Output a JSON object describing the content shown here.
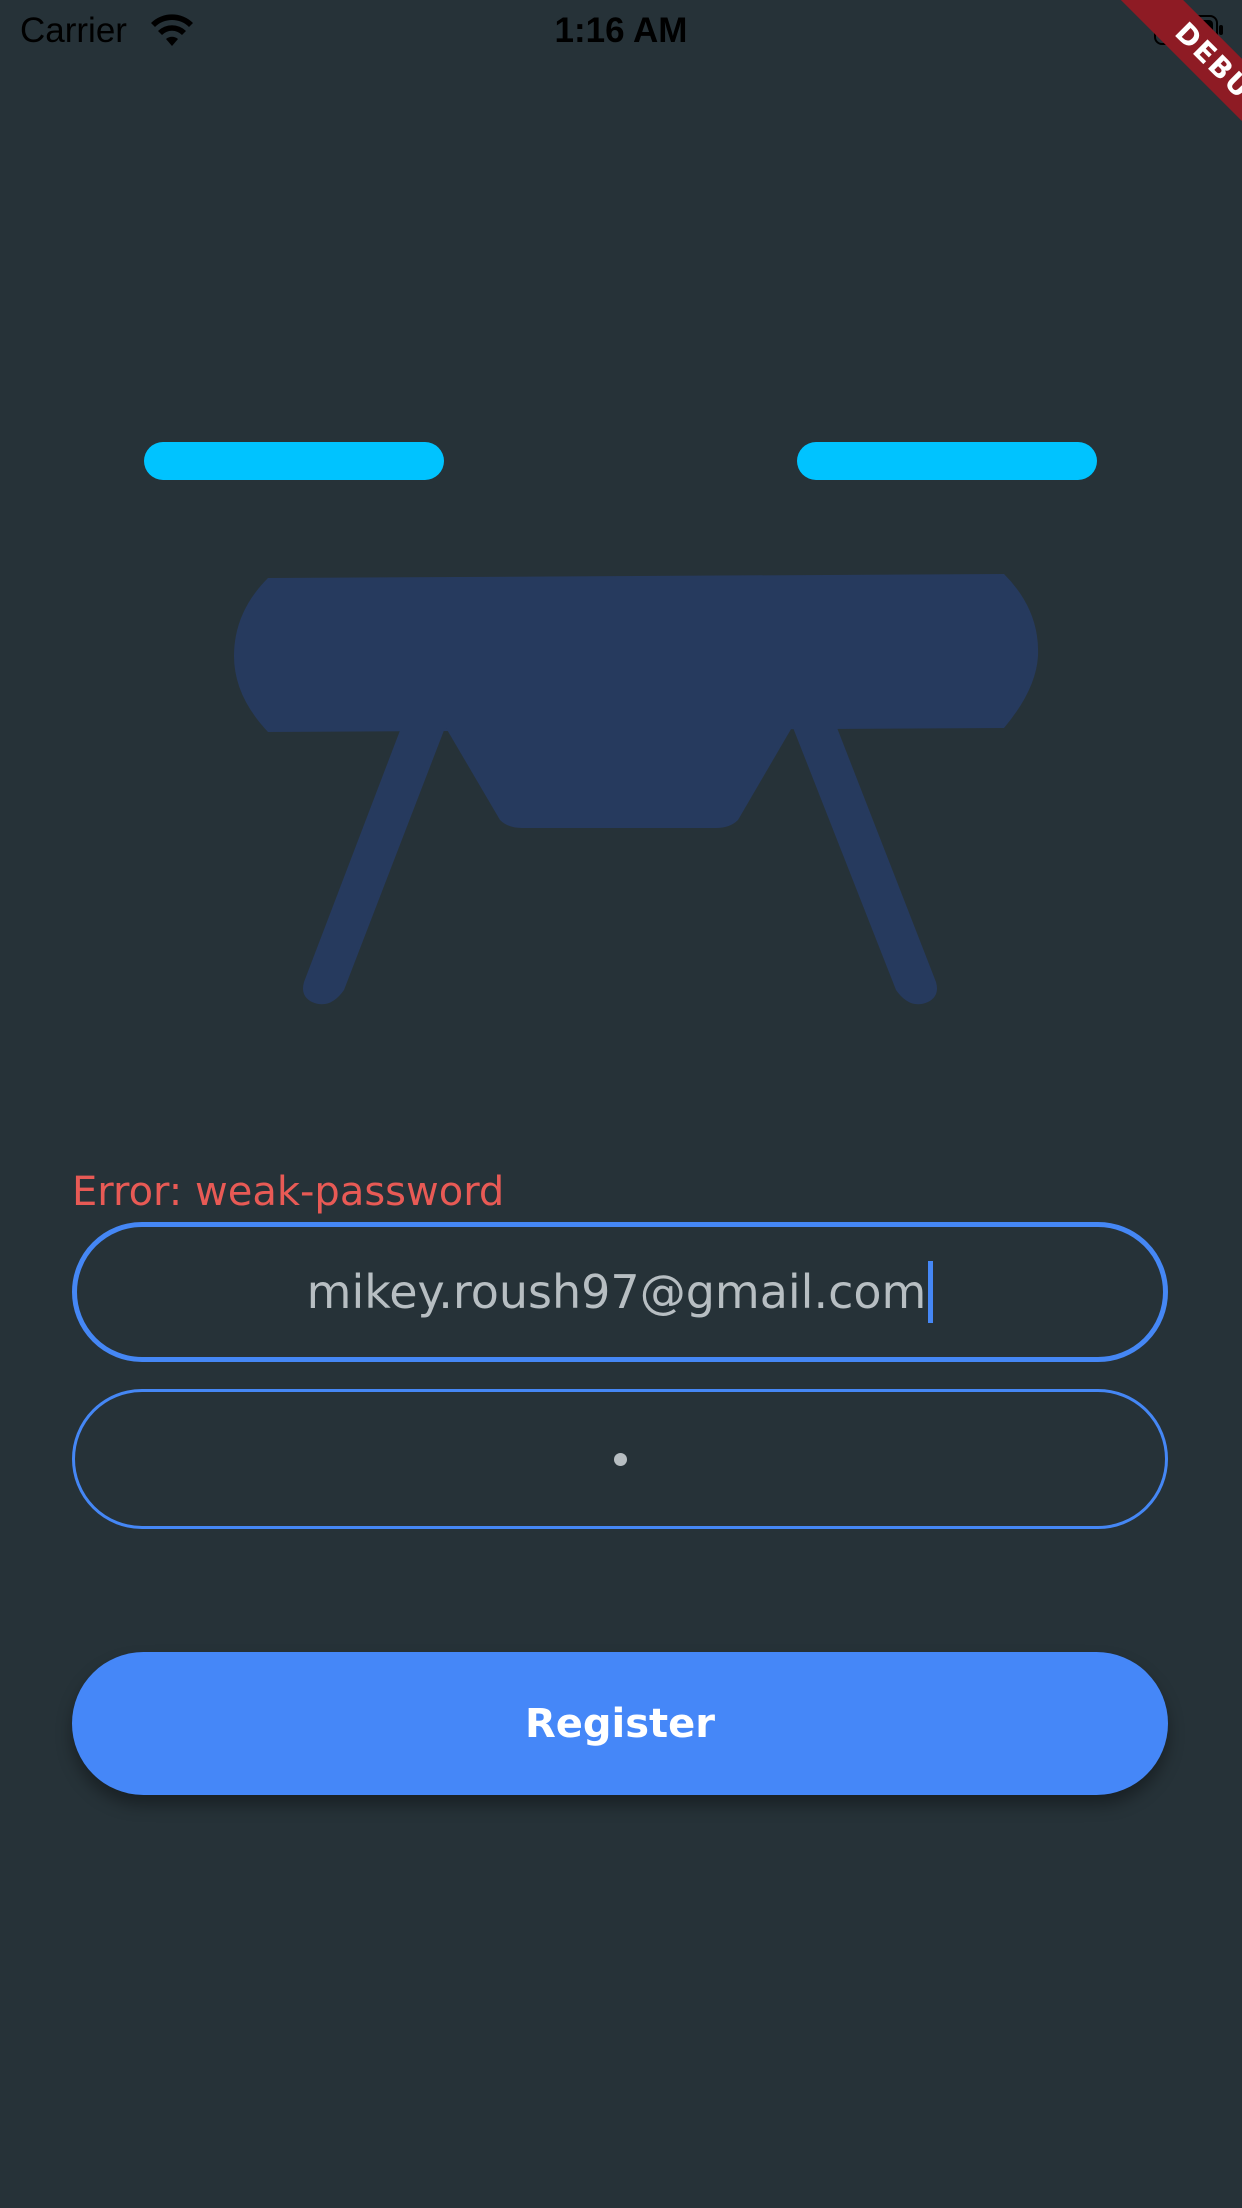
{
  "status_bar": {
    "carrier": "Carrier",
    "time": "1:16 AM",
    "wifi_icon": "wifi-icon",
    "battery_icon": "battery-icon"
  },
  "debug_banner": {
    "label": "DEBUG",
    "color": "#8e1b24"
  },
  "illustration": {
    "icon": "drone-icon",
    "rotor_color": "#00c3ff",
    "body_color": "#263a5e"
  },
  "form": {
    "error": "Error: weak-password",
    "email_value": "mikey.roush97@gmail.com",
    "password_mask": "•",
    "register_label": "Register",
    "accent_color": "#4587f5",
    "error_color": "#e85a55"
  },
  "theme": {
    "background": "#263238"
  }
}
